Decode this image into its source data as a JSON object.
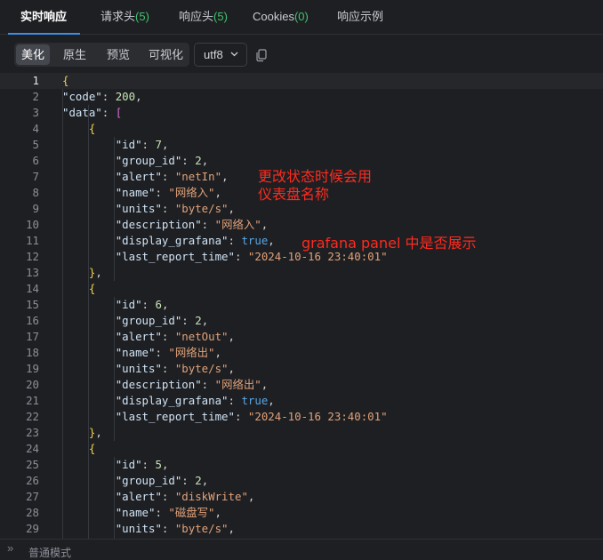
{
  "tabs": [
    {
      "label": "实时响应",
      "count": ""
    },
    {
      "label": "请求头",
      "count": "(5)"
    },
    {
      "label": "响应头",
      "count": "(5)"
    },
    {
      "label": "Cookies",
      "count": "(0)"
    },
    {
      "label": "响应示例",
      "count": ""
    }
  ],
  "toolbar": {
    "views": [
      "美化",
      "原生",
      "预览",
      "可视化"
    ],
    "encoding": "utf8",
    "icons": {
      "dropdown": "chevron-down-icon",
      "copy": "copy-icon"
    }
  },
  "code_lines": [
    "{",
    "    \"code\": 200,",
    "    \"data\": [",
    "        {",
    "            \"id\": 7,",
    "            \"group_id\": 2,",
    "            \"alert\": \"netIn\",",
    "            \"name\": \"网络入\",",
    "            \"units\": \"byte/s\",",
    "            \"description\": \"网络入\",",
    "            \"display_grafana\": true,",
    "            \"last_report_time\": \"2024-10-16 23:40:01\"",
    "        },",
    "        {",
    "            \"id\": 6,",
    "            \"group_id\": 2,",
    "            \"alert\": \"netOut\",",
    "            \"name\": \"网络出\",",
    "            \"units\": \"byte/s\",",
    "            \"description\": \"网络出\",",
    "            \"display_grafana\": true,",
    "            \"last_report_time\": \"2024-10-16 23:40:01\"",
    "        },",
    "        {",
    "            \"id\": 5,",
    "            \"group_id\": 2,",
    "            \"alert\": \"diskWrite\",",
    "            \"name\": \"磁盘写\",",
    "            \"units\": \"byte/s\","
  ],
  "annotations": {
    "name_note_line1": "更改状态时候会用",
    "name_note_line2": "仪表盘名称",
    "grafana_note": "grafana panel 中是否展示"
  },
  "footer": {
    "mode": "普通模式",
    "icon": "chevrons-right-icon"
  },
  "colors": {
    "accent": "#3a8ee6",
    "count_green": "#3ec46d",
    "annotation_red": "#ff2a1f"
  }
}
